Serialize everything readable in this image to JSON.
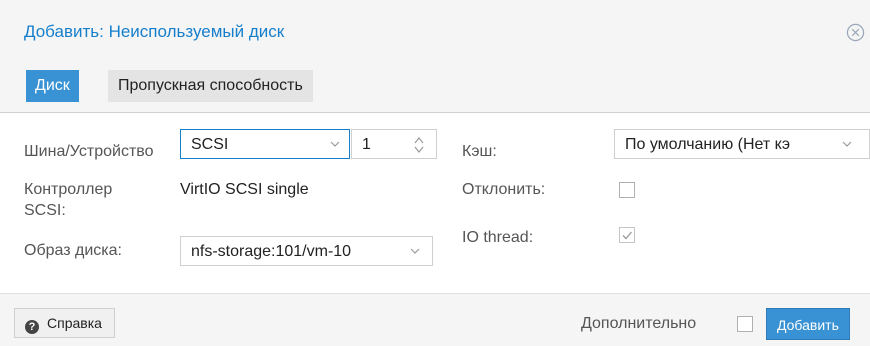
{
  "dialog": {
    "title": "Добавить: Неиспользуемый диск"
  },
  "tabs": [
    {
      "label": "Диск",
      "active": true
    },
    {
      "label": "Пропускная способность",
      "active": false
    }
  ],
  "form": {
    "bus_device_label": "Шина/Устройство",
    "bus_value": "SCSI",
    "device_number": "1",
    "scsi_controller_label_line1": "Контроллер",
    "scsi_controller_label_line2": "SCSI:",
    "scsi_controller_value": "VirtIO SCSI single",
    "disk_image_label": "Образ диска:",
    "disk_image_value": "nfs-storage:101/vm-10",
    "cache_label": "Кэш:",
    "cache_value": "По умолчанию (Нет кэ",
    "discard_label": "Отклонить:",
    "discard_checked": false,
    "io_thread_label": "IO thread:",
    "io_thread_checked": true
  },
  "footer": {
    "help_label": "Справка",
    "advanced_label": "Дополнительно",
    "advanced_checked": false,
    "add_label": "Добавить"
  },
  "colors": {
    "accent": "#3892d3",
    "title_blue": "#157fcc"
  }
}
